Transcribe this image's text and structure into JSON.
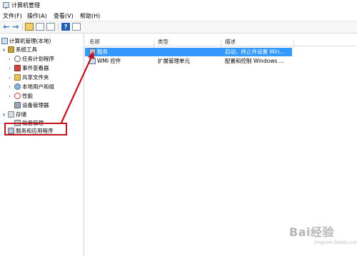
{
  "window": {
    "title": "计算机管理"
  },
  "menu": [
    "文件(F)",
    "操作(A)",
    "查看(V)",
    "帮助(H)"
  ],
  "tree": {
    "root": "计算机管理(本地)",
    "system_tools": "系统工具",
    "children": [
      "任务计划程序",
      "事件查看器",
      "共享文件夹",
      "本地用户和组",
      "性能",
      "设备管理器"
    ],
    "storage": "存储",
    "disk": "磁盘管理",
    "services_apps": "服务和应用程序"
  },
  "columns": {
    "name": "名称",
    "type": "类型",
    "desc": "描述"
  },
  "rows": [
    {
      "name": "服务",
      "type": "",
      "desc": "启动、终止并设置 Win..."
    },
    {
      "name": "WMI 控件",
      "type": "扩展管理单元",
      "desc": "配置和控制 Windows ..."
    }
  ],
  "watermark": {
    "brand": "Bai经验",
    "url": "jingyan.baidu.com"
  },
  "colors": {
    "selection": "#3399ff",
    "highlight": "#c0141c"
  }
}
